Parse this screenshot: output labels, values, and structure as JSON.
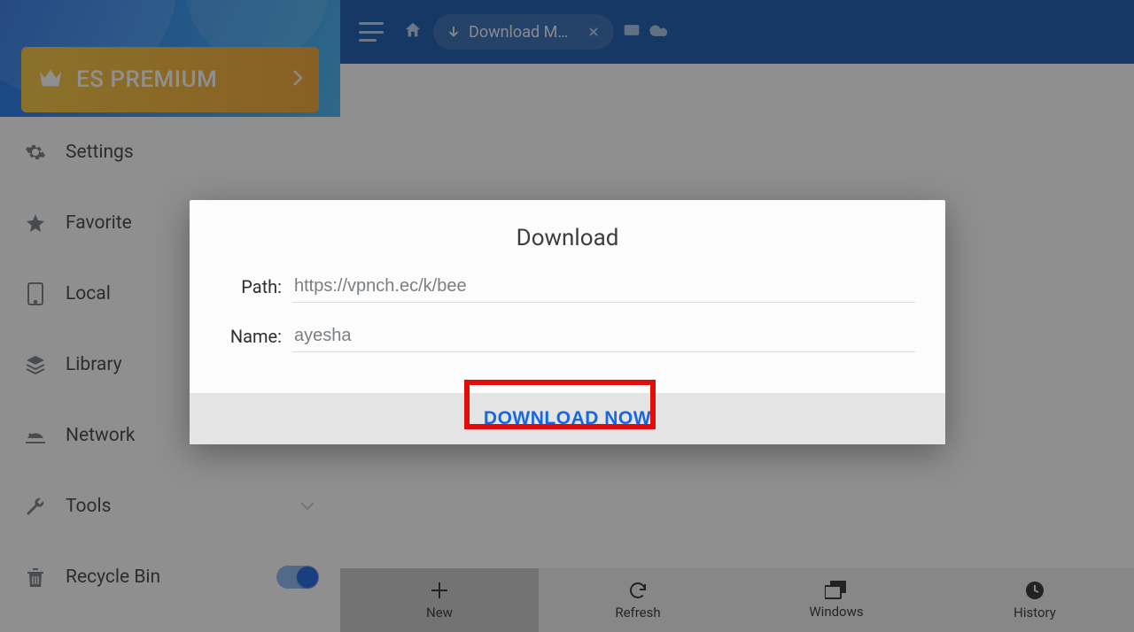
{
  "topbar": {
    "tab_label": "Download Ma…"
  },
  "premium": {
    "label": "ES PREMIUM"
  },
  "sidebar": {
    "items": [
      {
        "label": "Settings"
      },
      {
        "label": "Favorite"
      },
      {
        "label": "Local"
      },
      {
        "label": "Library"
      },
      {
        "label": "Network"
      },
      {
        "label": "Tools"
      },
      {
        "label": "Recycle Bin"
      }
    ]
  },
  "bottombar": {
    "new": "New",
    "refresh": "Refresh",
    "windows": "Windows",
    "history": "History"
  },
  "dialog": {
    "title": "Download",
    "path_label": "Path:",
    "name_label": "Name:",
    "path_value": "https://vpnch.ec/k/bee",
    "name_value": "ayesha",
    "download_btn": "DOWNLOAD NOW"
  }
}
